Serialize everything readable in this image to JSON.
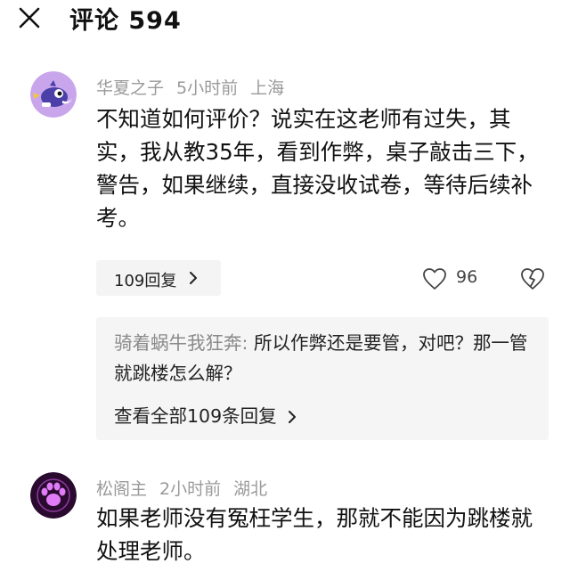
{
  "header": {
    "title": "评论 594",
    "close_icon": "close-icon"
  },
  "comments": [
    {
      "username": "华夏之子",
      "time": "5小时前",
      "location": "上海",
      "text": "不知道如何评价？说实在这老师有过失，其实，我从教35年，看到作弊，桌子敲击三下，警告，如果继续，直接没收试卷，等待后续补考。",
      "reply_button": "109回复",
      "likes": "96",
      "reply_preview": {
        "author": "骑着蜗牛我狂奔:",
        "text": " 所以作弊还是要管，对吧？那一管就跳楼怎么解？",
        "view_all": "查看全部109条回复"
      }
    },
    {
      "username": "松阁主",
      "time": "2小时前",
      "location": "湖北",
      "text": "如果老师没有冤枉学生，那就不能因为跳楼就处理老师。"
    }
  ],
  "colors": {
    "meta": "#9a9a9a",
    "reply_background": "#f5f5f5",
    "avatar_1_bg": "#c9a6ec",
    "avatar_2_bg": "#2a0a2e"
  }
}
